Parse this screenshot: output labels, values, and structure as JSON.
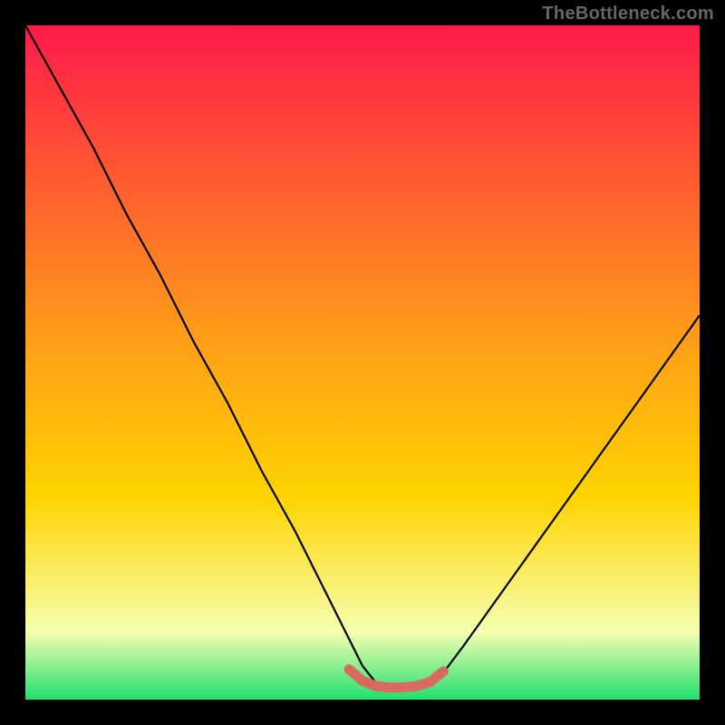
{
  "watermark": "TheBottleneck.com",
  "chart_data": {
    "type": "line",
    "title": "",
    "xlabel": "",
    "ylabel": "",
    "xlim": [
      0,
      100
    ],
    "ylim": [
      0,
      100
    ],
    "grid": false,
    "legend": false,
    "background_gradient": {
      "top_color": "#ff1a4a",
      "mid_color": "#ffd400",
      "bottom_color": "#20e070"
    },
    "series": [
      {
        "name": "bottleneck-curve",
        "color": "#000000",
        "x": [
          0,
          5,
          10,
          15,
          20,
          25,
          30,
          35,
          40,
          45,
          48,
          50,
          52,
          55,
          58,
          60,
          62,
          65,
          70,
          75,
          80,
          85,
          90,
          95,
          100
        ],
        "y": [
          100,
          91,
          82,
          72,
          63,
          53,
          44,
          34,
          25,
          15,
          9,
          5,
          2.5,
          1.5,
          1.5,
          2.5,
          4,
          8,
          15,
          22,
          29,
          36,
          43,
          50,
          57
        ]
      },
      {
        "name": "optimal-zone-marker",
        "color": "#d86a60",
        "thick": true,
        "x": [
          48,
          50,
          52,
          54,
          56,
          58,
          60,
          62
        ],
        "y": [
          4.5,
          2.8,
          2.0,
          1.8,
          1.8,
          2.0,
          2.6,
          4.2
        ]
      }
    ]
  }
}
